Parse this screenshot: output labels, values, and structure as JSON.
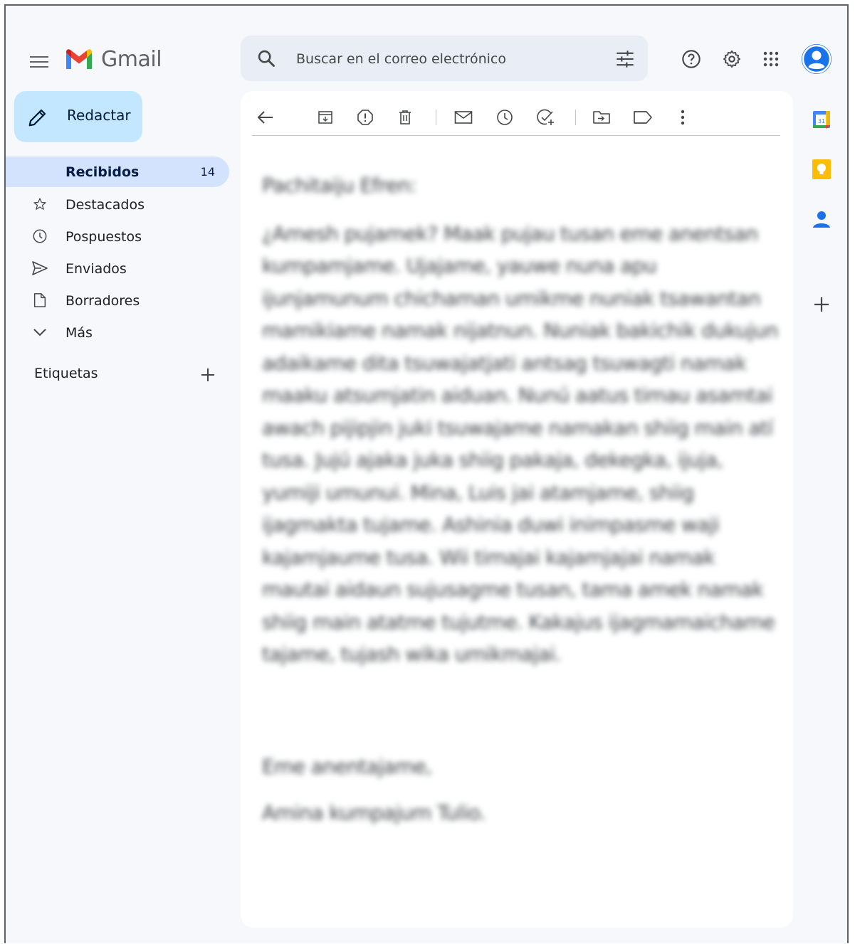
{
  "app": {
    "name": "Gmail"
  },
  "search": {
    "placeholder": "Buscar en el correo electrónico"
  },
  "compose": {
    "label": "Redactar"
  },
  "sidebar": {
    "items": [
      {
        "label": "Recibidos",
        "count": "14",
        "icon": "inbox-icon",
        "active": true
      },
      {
        "label": "Destacados",
        "icon": "star-icon"
      },
      {
        "label": "Pospuestos",
        "icon": "clock-icon"
      },
      {
        "label": "Enviados",
        "icon": "send-icon"
      },
      {
        "label": "Borradores",
        "icon": "draft-icon"
      },
      {
        "label": "Más",
        "icon": "chevron-down-icon"
      }
    ],
    "labels_header": "Etiquetas"
  },
  "email": {
    "greeting": "Pachitaiju Efren:",
    "paragraph": "¿Amesh pujamek? Maak pujau tusan eme anentsan kumpamjame. Ujajame, yauwe nuna apu ijunjamunum chichaman umikme nuniak tsawantan mamikiame namak nijatnun. Nuniak bakichik dukujun adaikame dita tsuwajatjati antsag tsuwagti namak maaku atsumjatin aiduan. Nunú aatus timau asamtai awach pijipjin juki tsuwajame namakan shiig main atí tusa. Jujú ajaka juka shiig pakaja, dekegka, ijuja, yumiji umunui. Mina, Luis jai atamjame, shiig ijagmakta tujame. Ashinia duwi inimpasme waji kajamjaume tusa. Wii timajai kajamjajai namak mautai aidaun sujusagme tusan, tama amek namak shiig main atatme tujutme. Kakajus ijagmamaichame tajame, tujash wika umikmajai.",
    "closing": "Eme anentajame,",
    "signature": "Amina kumpajum Tulio."
  },
  "colors": {
    "accent": "#1a73e8",
    "compose_bg": "#c2e7ff",
    "active_nav_bg": "#d3e3fd",
    "app_bg": "#f6f8fc"
  }
}
